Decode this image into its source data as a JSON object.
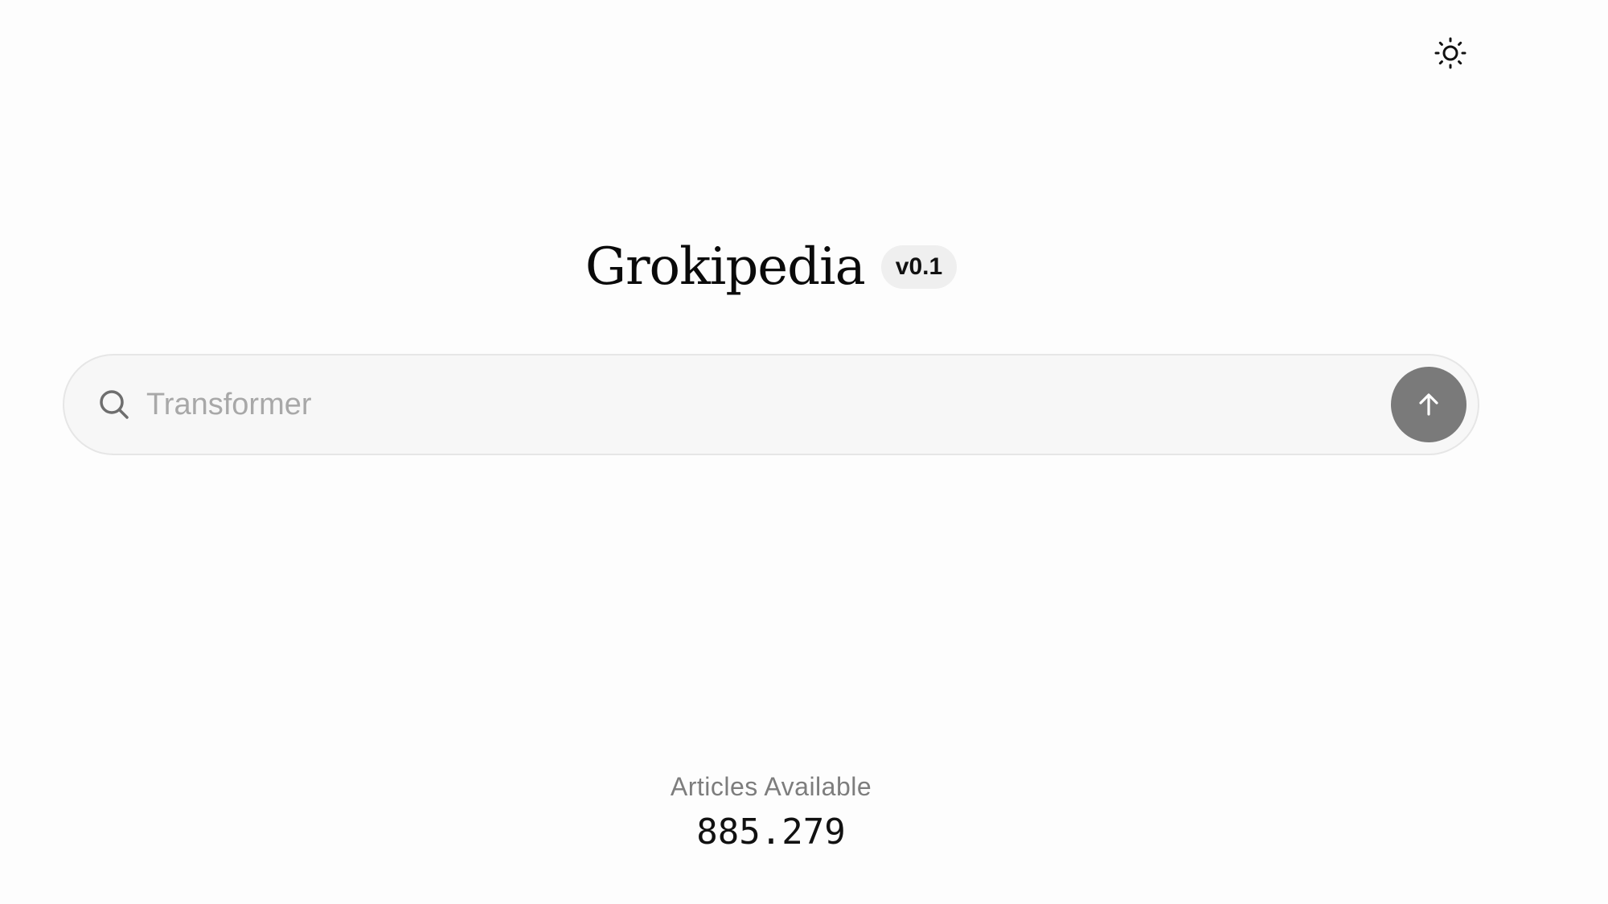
{
  "header": {
    "theme_toggle_icon": "sun-icon"
  },
  "brand": {
    "title": "Grokipedia",
    "version": "v0.1"
  },
  "search": {
    "placeholder": "Transformer",
    "value": "",
    "search_icon": "search-icon",
    "submit_icon": "arrow-up-icon",
    "submit_button_color": "#7a7a7a"
  },
  "stats": {
    "label": "Articles Available",
    "count": "885.279"
  }
}
